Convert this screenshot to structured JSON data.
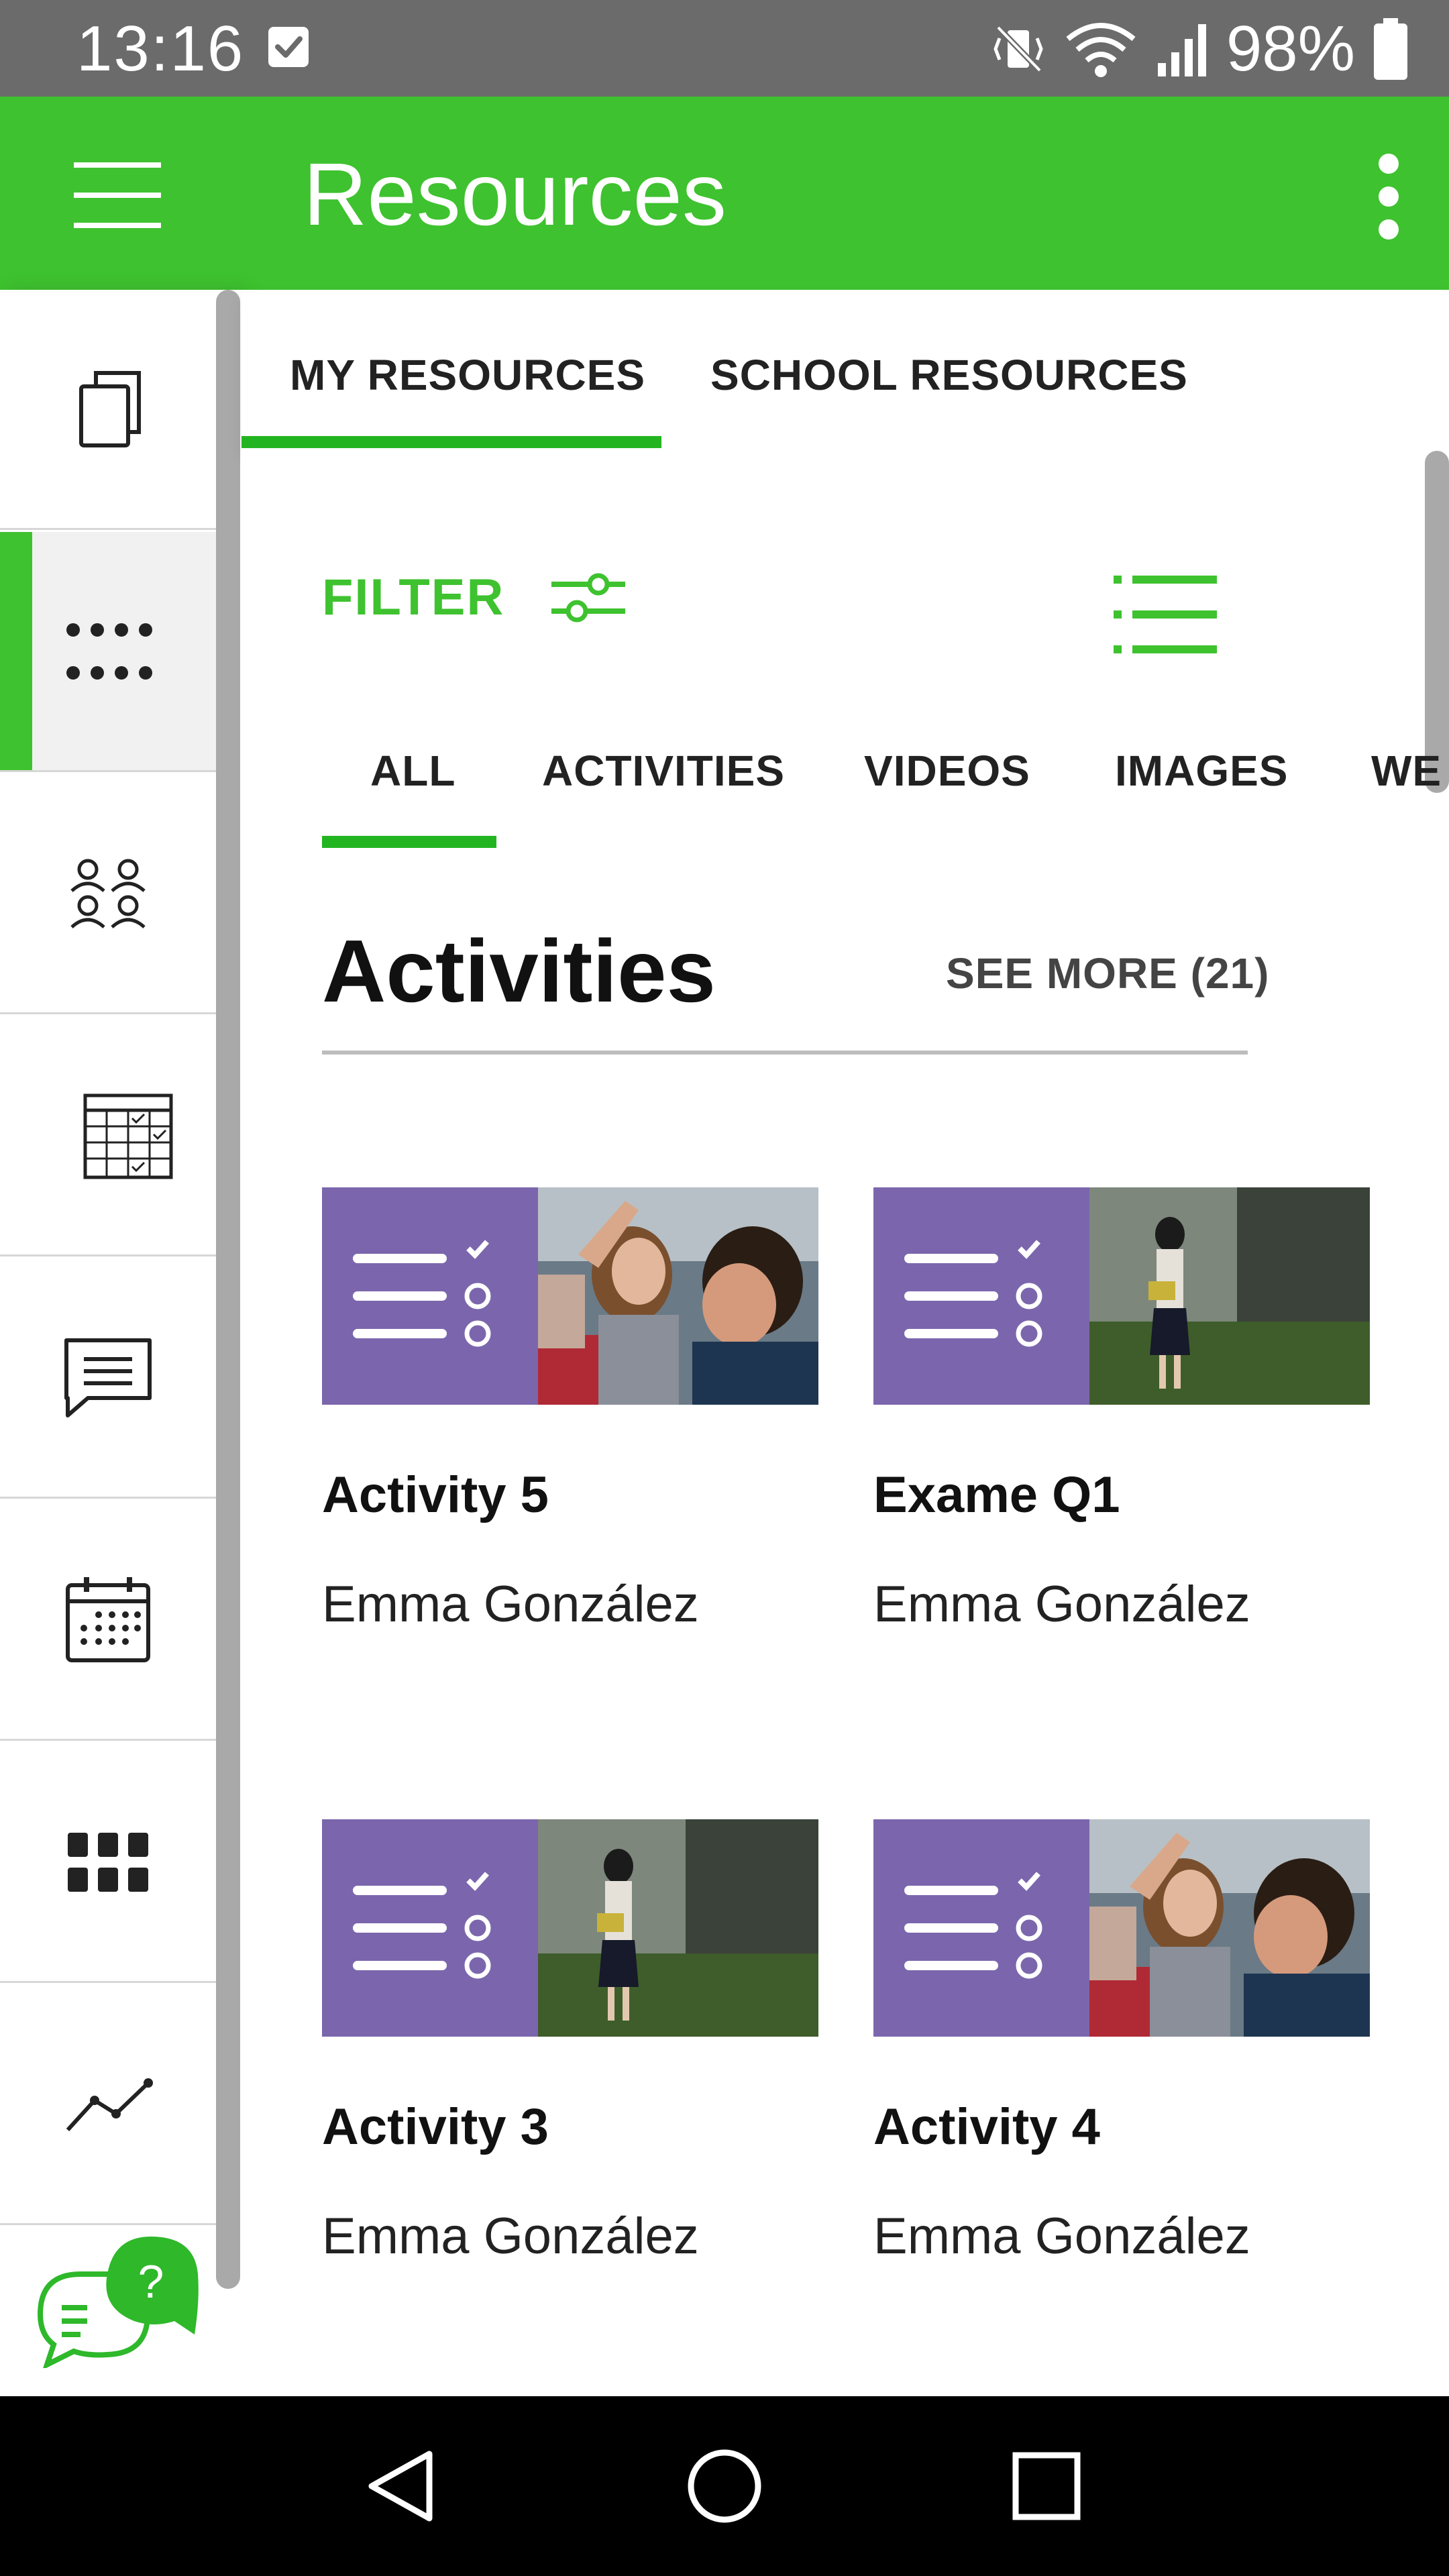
{
  "status_bar": {
    "time": "13:16",
    "battery": "98%"
  },
  "app_bar": {
    "title": "Resources",
    "menu_icon": "hamburger-menu-icon",
    "more_icon": "more-vertical-icon",
    "color": "#3ec22f"
  },
  "sidebar": {
    "items": [
      {
        "icon": "copy-pages-icon",
        "active": false
      },
      {
        "icon": "dots-grid-icon",
        "active": true
      },
      {
        "icon": "people-group-icon",
        "active": false
      },
      {
        "icon": "schedule-table-icon",
        "active": false
      },
      {
        "icon": "chat-message-icon",
        "active": false
      },
      {
        "icon": "calendar-icon",
        "active": false
      },
      {
        "icon": "apps-grid-icon",
        "active": false
      },
      {
        "icon": "trend-line-icon",
        "active": false
      }
    ],
    "help_icon": "help-chat-icon"
  },
  "tabs": [
    {
      "label": "MY RESOURCES",
      "active": true
    },
    {
      "label": "SCHOOL RESOURCES",
      "active": false
    }
  ],
  "filter": {
    "label": "FILTER",
    "icon": "sliders-icon",
    "view_icon": "list-view-icon"
  },
  "categories": [
    {
      "label": "ALL",
      "active": true
    },
    {
      "label": "ACTIVITIES",
      "active": false
    },
    {
      "label": "VIDEOS",
      "active": false
    },
    {
      "label": "IMAGES",
      "active": false
    },
    {
      "label": "WE",
      "active": false
    }
  ],
  "section": {
    "title": "Activities",
    "see_more": "SEE MORE (21)"
  },
  "cards": [
    {
      "title": "Activity 5",
      "author": "Emma González",
      "photo": "classroom-photo"
    },
    {
      "title": "Exame Q1",
      "author": "Emma González",
      "photo": "reading-girl-photo"
    },
    {
      "title": "Activity 3",
      "author": "Emma González",
      "photo": "reading-girl-photo"
    },
    {
      "title": "Activity 4",
      "author": "Emma González",
      "photo": "classroom-photo"
    }
  ],
  "nav_bar": {
    "back_icon": "back-triangle-icon",
    "home_icon": "home-circle-icon",
    "recents_icon": "recents-square-icon"
  }
}
